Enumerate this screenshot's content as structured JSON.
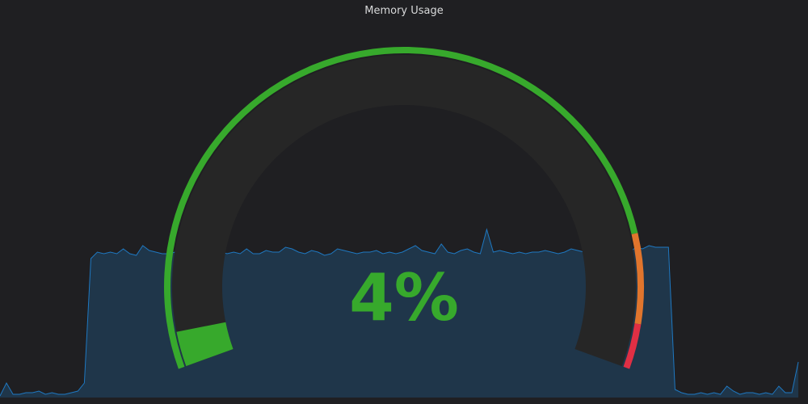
{
  "panel": {
    "title": "Memory Usage"
  },
  "gauge": {
    "value": 4,
    "value_text": "4%",
    "min": 0,
    "max": 100,
    "thresholds": [
      {
        "from": 0,
        "to": 85,
        "color": "#37a92c"
      },
      {
        "from": 85,
        "to": 95,
        "color": "#e0752d"
      },
      {
        "from": 95,
        "to": 100,
        "color": "#e02f44"
      }
    ],
    "value_color": "#37a92c",
    "track_color": "#262626"
  },
  "sparkline": {
    "line_color": "#1f78c1",
    "fill_color": "rgba(31,96,150,0.35)",
    "values": [
      1,
      9,
      2,
      2,
      3,
      3,
      4,
      2,
      3,
      2,
      2,
      3,
      4,
      9,
      86,
      90,
      89,
      90,
      89,
      92,
      89,
      88,
      94,
      91,
      90,
      89,
      89,
      90,
      91,
      89,
      87,
      89,
      90,
      91,
      90,
      89,
      90,
      89,
      92,
      89,
      89,
      91,
      90,
      90,
      93,
      92,
      90,
      89,
      91,
      90,
      88,
      89,
      92,
      91,
      90,
      89,
      90,
      90,
      91,
      89,
      90,
      89,
      90,
      92,
      94,
      91,
      90,
      89,
      95,
      90,
      89,
      91,
      92,
      90,
      89,
      104,
      90,
      91,
      90,
      89,
      90,
      89,
      90,
      90,
      91,
      90,
      89,
      90,
      92,
      91,
      90,
      89,
      90,
      92,
      94,
      91,
      92,
      90,
      93,
      92,
      94,
      93,
      93,
      93,
      5,
      3,
      2,
      2,
      3,
      2,
      3,
      2,
      7,
      4,
      2,
      3,
      3,
      2,
      3,
      2,
      7,
      3,
      3,
      22
    ]
  }
}
